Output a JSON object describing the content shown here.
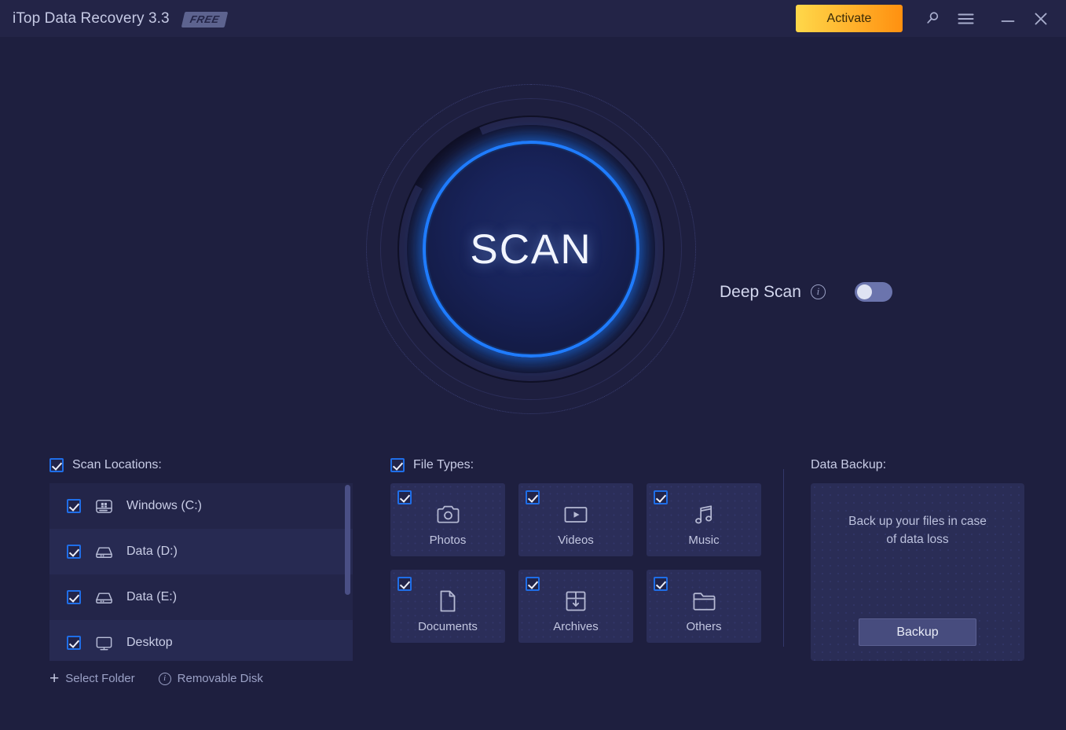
{
  "titlebar": {
    "app_title": "iTop Data Recovery 3.3",
    "badge": "FREE",
    "activate_label": "Activate",
    "icons": {
      "search": "search-icon",
      "menu": "hamburger-menu-icon",
      "minimize": "minimize-icon",
      "close": "close-icon"
    },
    "accent_color": "#ffb52e"
  },
  "scan": {
    "button_label": "SCAN",
    "glow_color": "#1f7cff"
  },
  "deep_scan": {
    "label": "Deep Scan",
    "info": "i",
    "toggle_state": "off"
  },
  "scan_locations": {
    "header": "Scan Locations:",
    "header_checked": true,
    "items": [
      {
        "label": "Windows (C:)",
        "icon": "windows-drive-icon",
        "checked": true
      },
      {
        "label": "Data (D:)",
        "icon": "drive-icon",
        "checked": true
      },
      {
        "label": "Data (E:)",
        "icon": "drive-icon",
        "checked": true
      },
      {
        "label": "Desktop",
        "icon": "monitor-icon",
        "checked": true
      }
    ],
    "links": [
      {
        "label": "Select Folder",
        "icon": "plus-icon"
      },
      {
        "label": "Removable Disk",
        "icon": "info-icon"
      }
    ]
  },
  "file_types": {
    "header": "File Types:",
    "header_checked": true,
    "items": [
      {
        "label": "Photos",
        "icon": "camera-icon",
        "checked": true
      },
      {
        "label": "Videos",
        "icon": "video-play-icon",
        "checked": true
      },
      {
        "label": "Music",
        "icon": "music-note-icon",
        "checked": true
      },
      {
        "label": "Documents",
        "icon": "document-icon",
        "checked": true
      },
      {
        "label": "Archives",
        "icon": "archive-box-icon",
        "checked": true
      },
      {
        "label": "Others",
        "icon": "folder-icon",
        "checked": true
      }
    ]
  },
  "data_backup": {
    "header": "Data Backup:",
    "description": "Back up your files in case\nof data loss",
    "button_label": "Backup"
  }
}
